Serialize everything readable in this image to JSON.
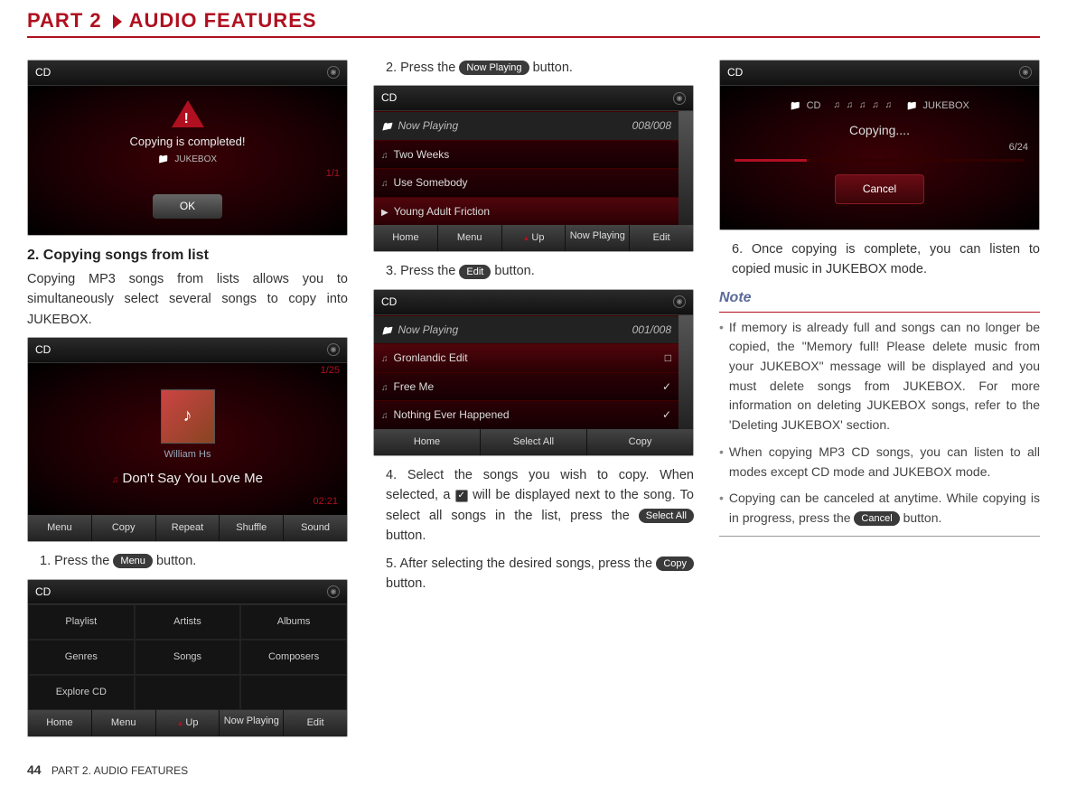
{
  "header": {
    "part": "PART 2",
    "title": "AUDIO FEATURES"
  },
  "col1": {
    "img1": {
      "cd": "CD",
      "msg": "Copying is completed!",
      "jb": "JUKEBOX",
      "count": "1/1",
      "ok": "OK"
    },
    "subhead": "2. Copying songs from list",
    "intro": "Copying MP3 songs from lists allows you to simultaneously select several songs to copy into JUKEBOX.",
    "img2": {
      "cd": "CD",
      "count": "1/25",
      "artist": "William Hs",
      "track": "Don't Say You Love Me",
      "time": "02:21",
      "btns": [
        "Menu",
        "Copy",
        "Repeat",
        "Shuffle",
        "Sound"
      ]
    },
    "step1a": "1. Press the ",
    "step1btn": "Menu",
    "step1b": " button.",
    "img3": {
      "cd": "CD",
      "cats": [
        "Playlist",
        "Artists",
        "Albums",
        "Genres",
        "Songs",
        "Composers",
        "Explore CD"
      ],
      "bottom": [
        "Home",
        "Menu",
        "Up",
        "Now Playing",
        "Edit"
      ]
    }
  },
  "col2": {
    "step2a": "2. Press the ",
    "step2btn": "Now Playing",
    "step2b": " button.",
    "img4": {
      "cd": "CD",
      "header": "Now Playing",
      "count": "008/008",
      "rows": [
        "Two Weeks",
        "Use Somebody",
        "Young Adult Friction"
      ],
      "bottom": [
        "Home",
        "Menu",
        "Up",
        "Now Playing",
        "Edit"
      ]
    },
    "step3a": "3. Press the ",
    "step3btn": "Edit",
    "step3b": " button.",
    "img5": {
      "cd": "CD",
      "header": "Now Playing",
      "count": "001/008",
      "rows": [
        "Gronlandic Edit",
        "Free Me",
        "Nothing Ever Happened"
      ],
      "bottom": [
        "Home",
        "Select All",
        "Copy"
      ]
    },
    "step4": "4. Select the songs you wish to copy. When selected, a ",
    "step4check": "✓",
    "step4b": " will be displayed next to the song. To select all songs in the list, press the ",
    "step4btn": "Select All",
    "step4c": " button.",
    "step5a": "5. After selecting the desired songs, press the ",
    "step5btn": "Copy",
    "step5b": " button."
  },
  "col3": {
    "img6": {
      "cd": "CD",
      "left": "CD",
      "right": "JUKEBOX",
      "label": "Copying....",
      "count": "6/24",
      "cancel": "Cancel"
    },
    "step6": "6. Once copying is complete, you can listen to copied music in JUKEBOX mode.",
    "noteHead": "Note",
    "n1": "If memory is already full and songs can no longer be copied, the \"Memory full! Please delete music from your JUKEBOX\" message will be displayed and you must delete songs from JUKEBOX. For more information on deleting JUKEBOX songs, refer to the 'Deleting JUKEBOX' section.",
    "n2": "When copying MP3 CD songs, you can listen to all modes except CD mode and JUKEBOX mode.",
    "n3a": "Copying can be canceled at anytime. While copying is in progress, press the ",
    "n3btn": "Cancel",
    "n3b": " button."
  },
  "footer": {
    "page": "44",
    "text": "PART 2. AUDIO FEATURES"
  }
}
